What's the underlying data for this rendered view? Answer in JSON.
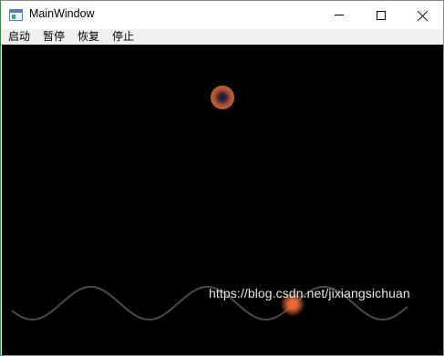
{
  "window": {
    "title": "MainWindow"
  },
  "menu": {
    "items": [
      {
        "label": "启动"
      },
      {
        "label": "暂停"
      },
      {
        "label": "恢复"
      },
      {
        "label": "停止"
      }
    ]
  },
  "icons": {
    "app": "app-window-icon",
    "minimize": "minimize-icon",
    "maximize": "maximize-icon",
    "close": "close-icon"
  },
  "colors": {
    "canvas_background": "#000000",
    "line_start": "#5a5a5a",
    "line_end": "#c63a3a",
    "wave_stroke": "#4a4a4a",
    "ball_outer": "#c8603a",
    "glow_orange": "#ff7a3c"
  },
  "watermark": {
    "text": "https://blog.csdn.net/jixiangsichuan"
  }
}
